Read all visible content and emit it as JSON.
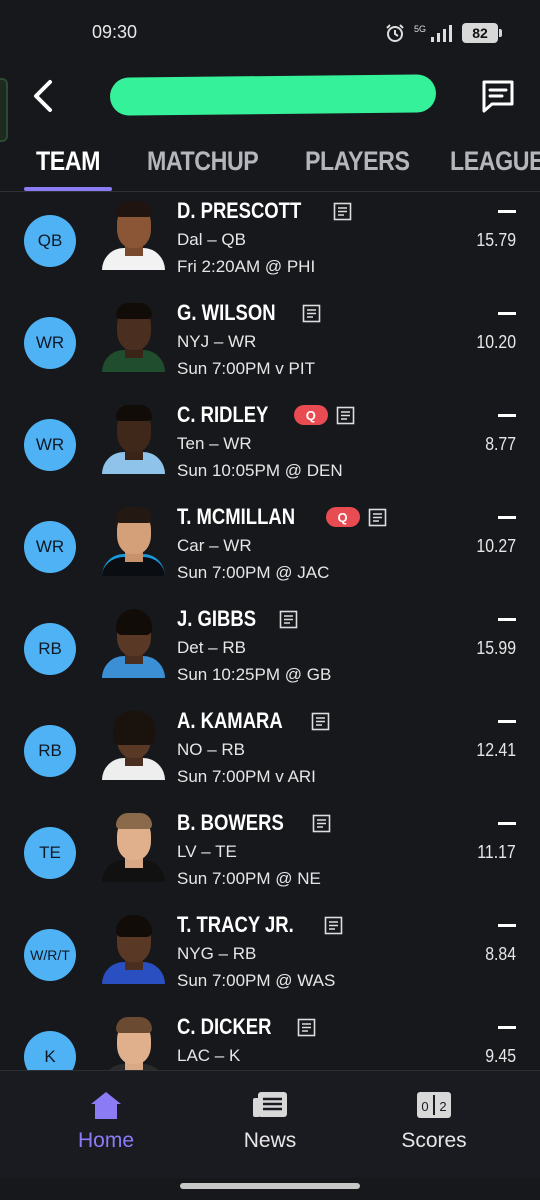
{
  "status": {
    "time": "09:30",
    "network": "5G",
    "battery": "82"
  },
  "header": {
    "title": ""
  },
  "tabs": [
    {
      "label": "TEAM"
    },
    {
      "label": "MATCHUP"
    },
    {
      "label": "PLAYERS"
    },
    {
      "label": "LEAGUE"
    }
  ],
  "roster": [
    {
      "position": "QB",
      "name": "D. PRESCOTT",
      "injury": "",
      "team_pos": "Dal – QB",
      "game": "Fri 2:20AM @ PHI",
      "actual": "—",
      "projected": "15.79"
    },
    {
      "position": "WR",
      "name": "G. WILSON",
      "injury": "",
      "team_pos": "NYJ – WR",
      "game": "Sun 7:00PM v PIT",
      "actual": "—",
      "projected": "10.20"
    },
    {
      "position": "WR",
      "name": "C. RIDLEY",
      "injury": "Q",
      "team_pos": "Ten – WR",
      "game": "Sun 10:05PM @ DEN",
      "actual": "—",
      "projected": "8.77"
    },
    {
      "position": "WR",
      "name": "T. MCMILLAN",
      "injury": "Q",
      "team_pos": "Car – WR",
      "game": "Sun 7:00PM @ JAC",
      "actual": "—",
      "projected": "10.27"
    },
    {
      "position": "RB",
      "name": "J. GIBBS",
      "injury": "",
      "team_pos": "Det – RB",
      "game": "Sun 10:25PM @ GB",
      "actual": "—",
      "projected": "15.99"
    },
    {
      "position": "RB",
      "name": "A. KAMARA",
      "injury": "",
      "team_pos": "NO – RB",
      "game": "Sun 7:00PM v ARI",
      "actual": "—",
      "projected": "12.41"
    },
    {
      "position": "TE",
      "name": "B. BOWERS",
      "injury": "",
      "team_pos": "LV – TE",
      "game": "Sun 7:00PM @ NE",
      "actual": "—",
      "projected": "11.17"
    },
    {
      "position": "W/R/T",
      "name": "T. TRACY JR.",
      "injury": "",
      "team_pos": "NYG – RB",
      "game": "Sun 7:00PM @ WAS",
      "actual": "—",
      "projected": "8.84"
    },
    {
      "position": "K",
      "name": "C. DICKER",
      "injury": "",
      "team_pos": "LAC – K",
      "game": "",
      "actual": "—",
      "projected": "9.45"
    }
  ],
  "colors": {
    "accent": "#8b7cf6",
    "position_badge": "#4fb2f5",
    "injury_badge": "#e94b52",
    "redaction": "#35f29a",
    "background": "#17181c"
  },
  "bottom_nav": [
    {
      "label": "Home",
      "icon": "home-icon"
    },
    {
      "label": "News",
      "icon": "news-icon"
    },
    {
      "label": "Scores",
      "icon": "scores-icon"
    }
  ]
}
